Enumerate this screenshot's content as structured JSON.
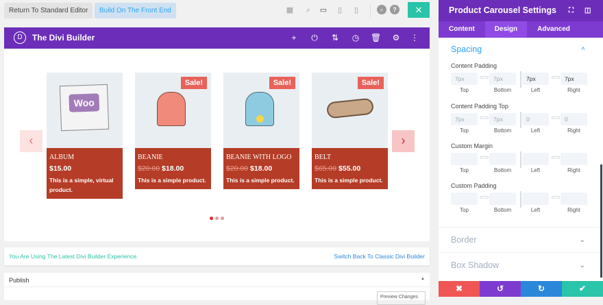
{
  "toolbar": {
    "return_label": "Return To Standard Editor",
    "front_label": "Build On The Front End",
    "close": "✕"
  },
  "builder": {
    "title": "The Divi Builder",
    "logo": "D"
  },
  "products": [
    {
      "name": "ALBUM",
      "old_price": "",
      "price": "$15.00",
      "desc": "This is a simple, virtual product.",
      "sale": ""
    },
    {
      "name": "BEANIE",
      "old_price": "$20.00",
      "price": "$18.00",
      "desc": "This is a simple product.",
      "sale": "Sale!"
    },
    {
      "name": "BEANIE WITH LOGO",
      "old_price": "$20.00",
      "price": "$18.00",
      "desc": "This is a simple product.",
      "sale": "Sale!"
    },
    {
      "name": "BELT",
      "old_price": "$65.00",
      "price": "$55.00",
      "desc": "This is a simple product.",
      "sale": "Sale!"
    }
  ],
  "album_art": "Woo",
  "notice": {
    "text": "You Are Using The Latest Divi Builder Experience.",
    "link": "Switch Back To Classic Divi Builder"
  },
  "publish": {
    "title": "Publish",
    "preview": "Preview Changes"
  },
  "panel": {
    "title": "Product Carousel Settings",
    "tabs": [
      "Content",
      "Design",
      "Advanced"
    ],
    "section": "Spacing",
    "groups": [
      {
        "label": "Content Padding",
        "values": [
          "7px",
          "7px",
          "7px",
          "7px"
        ]
      },
      {
        "label": "Content Padding Top",
        "values": [
          "7px",
          "7px",
          "0",
          "0"
        ]
      },
      {
        "label": "Custom Margin",
        "values": [
          "",
          "",
          "",
          ""
        ]
      },
      {
        "label": "Custom Padding",
        "values": [
          "",
          "",
          "",
          ""
        ]
      }
    ],
    "sublabels": [
      "Top",
      "Bottom",
      "Left",
      "Right"
    ],
    "collapsed": [
      "Border",
      "Box Shadow"
    ]
  },
  "colors": {
    "purple": "#6c2eb9",
    "green": "#29c4a9",
    "red": "#ef5555",
    "blue": "#2b87da",
    "card": "#b53c27"
  }
}
